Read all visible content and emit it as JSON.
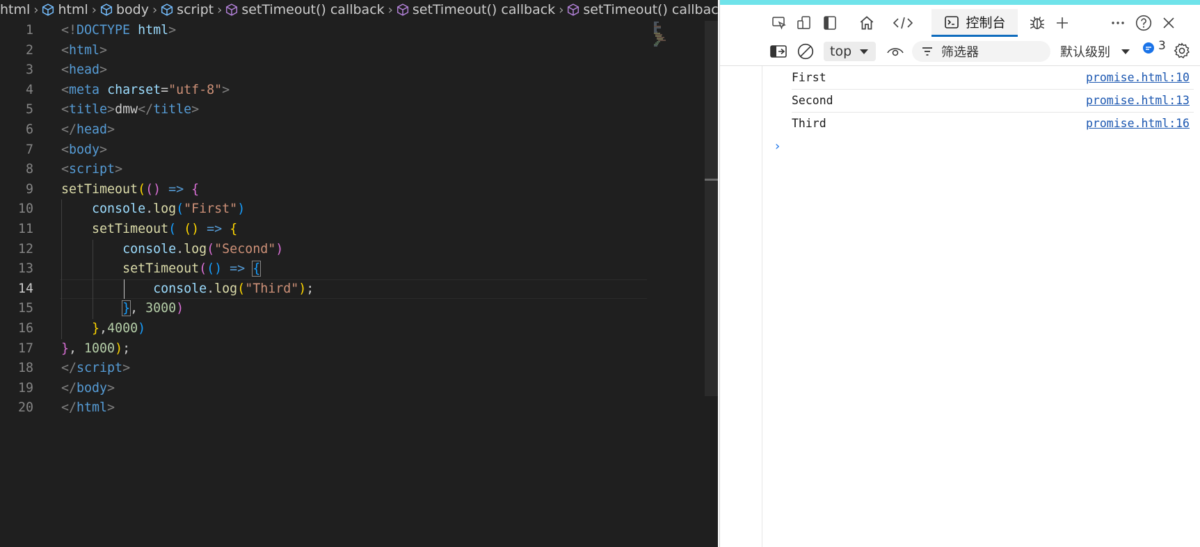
{
  "breadcrumb": [
    {
      "label": "html",
      "icon": null
    },
    {
      "label": "html",
      "icon": "element-icon"
    },
    {
      "label": "body",
      "icon": "element-icon"
    },
    {
      "label": "script",
      "icon": "element-icon"
    },
    {
      "label": "setTimeout() callback",
      "icon": "function-icon"
    },
    {
      "label": "setTimeout() callback",
      "icon": "function-icon"
    },
    {
      "label": "setTimeout() callback",
      "icon": "function-icon"
    }
  ],
  "editor": {
    "line_numbers": [
      "1",
      "2",
      "3",
      "4",
      "5",
      "6",
      "7",
      "8",
      "9",
      "10",
      "11",
      "12",
      "13",
      "14",
      "15",
      "16",
      "17",
      "18",
      "19",
      "20"
    ],
    "active_line": "14"
  },
  "devtools": {
    "tab_console_label": "控制台",
    "context_label": "top",
    "filter_placeholder": "筛选器",
    "level_label": "默认级别",
    "issue_count": "3",
    "messages": [
      {
        "text": "First",
        "source": "promise.html:10"
      },
      {
        "text": "Second",
        "source": "promise.html:13"
      },
      {
        "text": "Third",
        "source": "promise.html:16"
      }
    ],
    "prompt_symbol": "›"
  },
  "colors": {
    "editor_bg": "#1f1f1f",
    "accent": "#0f6cbd",
    "link": "#1a56b0",
    "top_strip": "#6fe3ea"
  }
}
